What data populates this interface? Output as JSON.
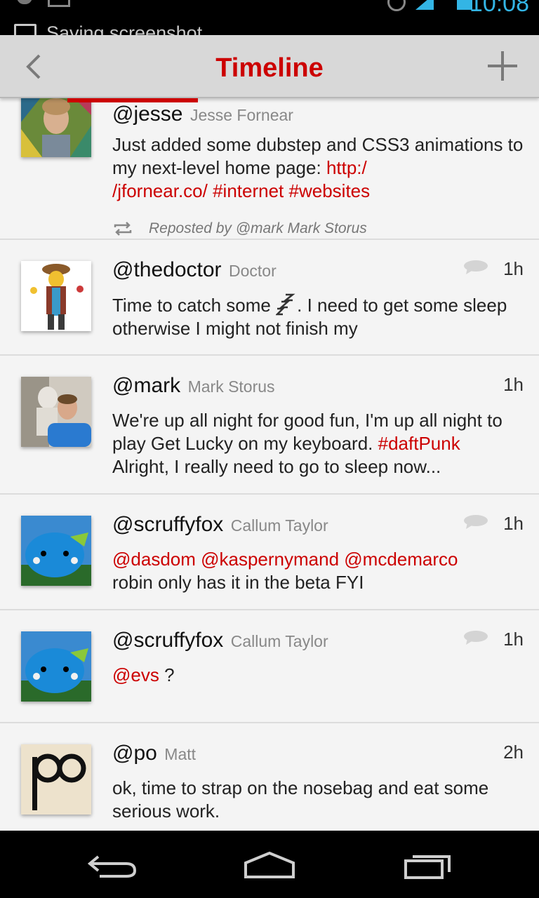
{
  "status_bar": {
    "clock": "10:08",
    "notification": "Saving screenshot"
  },
  "action_bar": {
    "title": "Timeline",
    "back_icon": "chevron-left-icon",
    "add_icon": "plus-icon"
  },
  "colors": {
    "accent": "#cc0000",
    "action_bar_bg": "#d8d8d8",
    "timeline_bg": "#f4f4f4"
  },
  "tweets": [
    {
      "handle": "@jesse",
      "name": "Jesse Fornear",
      "time": "",
      "body_prefix": "Just added some dubstep and CSS3 animations to my next-level home page: ",
      "link": "http://jfornear.co/",
      "link_line1": "http:/",
      "link_line2": "/jfornear.co/",
      "tag1": "#internet",
      "tag2": "#websites",
      "repost": "Reposted by @mark Mark Storus"
    },
    {
      "handle": "@thedoctor",
      "name": "Doctor",
      "time": "1h",
      "body_a": "Time to catch some",
      "body_b": ". I need to get some sleep otherwise I might not finish my"
    },
    {
      "handle": "@mark",
      "name": "Mark Storus",
      "time": "1h",
      "body_a": "We're up all night for good fun, I'm up all night to play Get Lucky on my keyboard. ",
      "tag": "#daftPunk",
      "body_b": "Alright, I really need to go to sleep now..."
    },
    {
      "handle": "@scruffyfox",
      "name": "Callum Taylor",
      "time": "1h",
      "mentions": "@dasdom @kaspernymand @mcdemarco",
      "body": "robin only has it in the beta FYI"
    },
    {
      "handle": "@scruffyfox",
      "name": "Callum Taylor",
      "time": "1h",
      "mention": "@evs",
      "body": " ?"
    },
    {
      "handle": "@po",
      "name": "Matt",
      "time": "2h",
      "body": "ok, time to strap on the nosebag and eat some serious work."
    }
  ],
  "nav": {
    "back_icon": "back-arrow-icon",
    "home_icon": "home-icon",
    "recents_icon": "recent-apps-icon"
  }
}
